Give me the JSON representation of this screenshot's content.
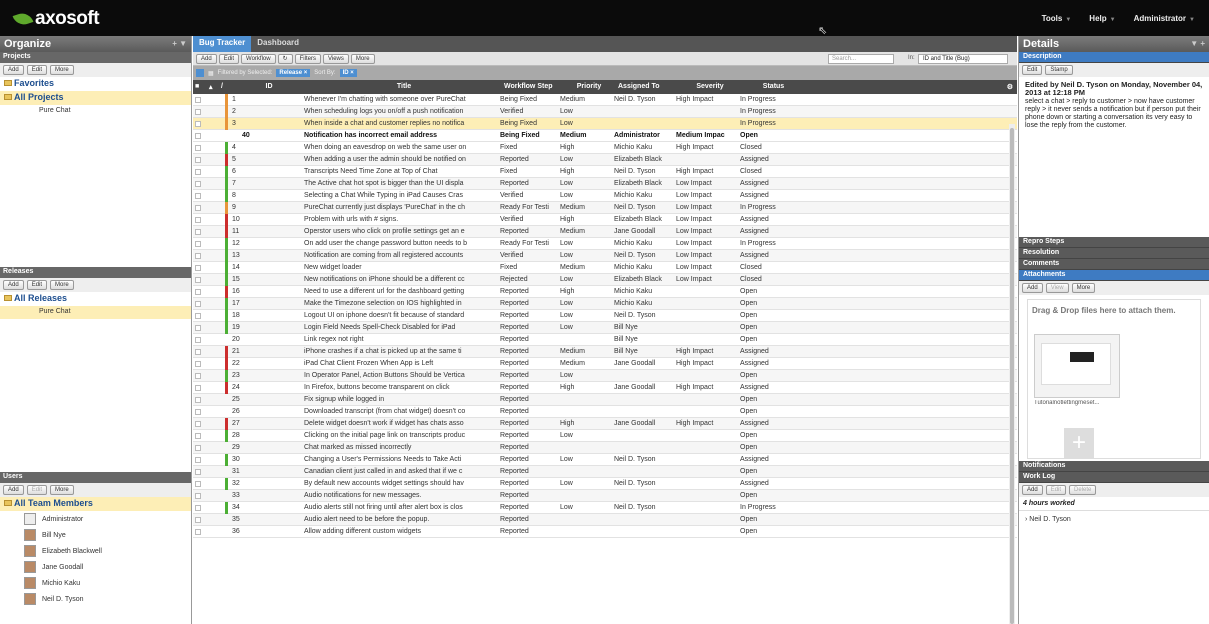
{
  "brand": "axosoft",
  "top_menu": [
    {
      "label": "Tools"
    },
    {
      "label": "Help"
    },
    {
      "label": "Administrator"
    }
  ],
  "organize": {
    "title": "Organize",
    "projects": {
      "header": "Projects",
      "buttons": [
        "Add",
        "Edit",
        "More"
      ],
      "tree": [
        {
          "label": "Favorites"
        },
        {
          "label": "All Projects"
        }
      ],
      "children": [
        "Pure Chat"
      ]
    },
    "releases": {
      "header": "Releases",
      "buttons": [
        "Add",
        "Edit",
        "More"
      ],
      "root": "All Releases",
      "children": [
        "Pure Chat"
      ]
    },
    "users": {
      "header": "Users",
      "buttons": [
        "Add",
        "Edit",
        "More"
      ],
      "root": "All Team Members",
      "members": [
        "Administrator",
        "Bill Nye",
        "Elizabeth Blackwell",
        "Jane Goodall",
        "Michio Kaku",
        "Neil D. Tyson"
      ]
    }
  },
  "tabs": [
    {
      "label": "Bug Tracker",
      "active": true
    },
    {
      "label": "Dashboard",
      "active": false
    }
  ],
  "toolbar": {
    "buttons": [
      "Add",
      "Edit",
      "Workflow",
      "Filters",
      "Views",
      "More"
    ],
    "search_placeholder": "Search...",
    "in_label": "In:",
    "in_value": "ID and Title (Bug)"
  },
  "filter_bar": {
    "filtered_label": "Filtered by Selected:",
    "filter_chip": "Release",
    "sort_label": "Sort By:",
    "sort_chip": "ID"
  },
  "columns": {
    "id": "ID",
    "title": "Title",
    "workflow": "Workflow Step",
    "priority": "Priority",
    "assigned": "Assigned To",
    "severity": "Severity",
    "status": "Status"
  },
  "colors": {
    "accent": "#4e8fd1",
    "selected_row": "#fdeeb6",
    "red": "#cc2e2e",
    "green": "#4caf35",
    "orange": "#e8953a"
  },
  "rows": [
    {
      "id": "1",
      "title": "Whenever I'm chatting with someone over PureChat",
      "wf": "Being Fixed",
      "pr": "Medium",
      "as": "Neil D. Tyson",
      "sv": "High Impact",
      "st": "In Progress",
      "bar": "orange"
    },
    {
      "id": "2",
      "title": "When scheduling logs you on/off a push notification",
      "wf": "Verified",
      "pr": "Low",
      "as": "",
      "sv": "",
      "st": "In Progress",
      "bar": "orange"
    },
    {
      "id": "3",
      "title": "When inside a chat and customer replies no notifica",
      "wf": "Being Fixed",
      "pr": "Low",
      "as": "",
      "sv": "",
      "st": "In Progress",
      "bar": "orange",
      "sel": true
    },
    {
      "id": "40",
      "title": "Notification has incorrect email address",
      "wf": "Being Fixed",
      "pr": "Medium",
      "as": "Administrator",
      "sv": "Medium Impac",
      "st": "Open",
      "bar": "",
      "sub": true
    },
    {
      "id": "4",
      "title": "When doing an eavesdrop on web the same user on",
      "wf": "Fixed",
      "pr": "High",
      "as": "Michio Kaku",
      "sv": "High Impact",
      "st": "Closed",
      "bar": "green"
    },
    {
      "id": "5",
      "title": "When adding a user the admin should be notified on",
      "wf": "Reported",
      "pr": "Low",
      "as": "Elizabeth Black",
      "sv": "",
      "st": "Assigned",
      "bar": "red"
    },
    {
      "id": "6",
      "title": "Transcripts Need Time Zone at Top of Chat",
      "wf": "Fixed",
      "pr": "High",
      "as": "Neil D. Tyson",
      "sv": "High Impact",
      "st": "Closed",
      "bar": "green"
    },
    {
      "id": "7",
      "title": "The Active chat hot spot is bigger than the UI displa",
      "wf": "Reported",
      "pr": "Low",
      "as": "Elizabeth Black",
      "sv": "Low Impact",
      "st": "Assigned",
      "bar": "green"
    },
    {
      "id": "8",
      "title": "Selecting a Chat While Typing in iPad Causes Cras",
      "wf": "Verified",
      "pr": "Low",
      "as": "Michio Kaku",
      "sv": "Low Impact",
      "st": "Assigned",
      "bar": "green"
    },
    {
      "id": "9",
      "title": "PureChat currently just displays 'PureChat' in the ch",
      "wf": "Ready For Testi",
      "pr": "Medium",
      "as": "Neil D. Tyson",
      "sv": "Low Impact",
      "st": "In Progress",
      "bar": "orange"
    },
    {
      "id": "10",
      "title": "Problem with urls with # signs.",
      "wf": "Verified",
      "pr": "High",
      "as": "Elizabeth Black",
      "sv": "Low Impact",
      "st": "Assigned",
      "bar": "red"
    },
    {
      "id": "11",
      "title": "Operstor users who click on profile settings get an e",
      "wf": "Reported",
      "pr": "Medium",
      "as": "Jane Goodall",
      "sv": "Low Impact",
      "st": "Assigned",
      "bar": "red"
    },
    {
      "id": "12",
      "title": "On add user the change password button needs to b",
      "wf": "Ready For Testi",
      "pr": "Low",
      "as": "Michio Kaku",
      "sv": "Low Impact",
      "st": "In Progress",
      "bar": "green"
    },
    {
      "id": "13",
      "title": "Notification are coming from all registered accounts",
      "wf": "Verified",
      "pr": "Low",
      "as": "Neil D. Tyson",
      "sv": "Low Impact",
      "st": "Assigned",
      "bar": "green"
    },
    {
      "id": "14",
      "title": "New widget loader",
      "wf": "Fixed",
      "pr": "Medium",
      "as": "Michio Kaku",
      "sv": "Low Impact",
      "st": "Closed",
      "bar": "green"
    },
    {
      "id": "15",
      "title": "New notifications on iPhone should be a different cc",
      "wf": "Rejected",
      "pr": "Low",
      "as": "Elizabeth Black",
      "sv": "Low Impact",
      "st": "Closed",
      "bar": "green"
    },
    {
      "id": "16",
      "title": "Need to use a different url for the dashboard getting",
      "wf": "Reported",
      "pr": "High",
      "as": "Michio Kaku",
      "sv": "",
      "st": "Open",
      "bar": "red"
    },
    {
      "id": "17",
      "title": "Make the Timezone selection on IOS highlighted in",
      "wf": "Reported",
      "pr": "Low",
      "as": "Michio Kaku",
      "sv": "",
      "st": "Open",
      "bar": "green"
    },
    {
      "id": "18",
      "title": "Logout UI on iphone doesn't fit because of standard",
      "wf": "Reported",
      "pr": "Low",
      "as": "Neil D. Tyson",
      "sv": "",
      "st": "Open",
      "bar": "green"
    },
    {
      "id": "19",
      "title": "Login Field Needs Spell-Check Disabled for iPad",
      "wf": "Reported",
      "pr": "Low",
      "as": "Bill Nye",
      "sv": "",
      "st": "Open",
      "bar": "green"
    },
    {
      "id": "20",
      "title": "Link regex not right",
      "wf": "Reported",
      "pr": "",
      "as": "Bill Nye",
      "sv": "",
      "st": "Open",
      "bar": ""
    },
    {
      "id": "21",
      "title": "iPhone crashes if a chat is picked up at the same ti",
      "wf": "Reported",
      "pr": "Medium",
      "as": "Bill Nye",
      "sv": "High Impact",
      "st": "Assigned",
      "bar": "red"
    },
    {
      "id": "22",
      "title": "iPad Chat Client Frozen When App is Left",
      "wf": "Reported",
      "pr": "Medium",
      "as": "Jane Goodall",
      "sv": "High Impact",
      "st": "Assigned",
      "bar": "red"
    },
    {
      "id": "23",
      "title": "In Operator Panel, Action Buttons Should be Vertica",
      "wf": "Reported",
      "pr": "Low",
      "as": "",
      "sv": "",
      "st": "Open",
      "bar": "green"
    },
    {
      "id": "24",
      "title": "In Firefox, buttons become transparent on click",
      "wf": "Reported",
      "pr": "High",
      "as": "Jane Goodall",
      "sv": "High Impact",
      "st": "Assigned",
      "bar": "red"
    },
    {
      "id": "25",
      "title": "Fix signup while logged in",
      "wf": "Reported",
      "pr": "",
      "as": "",
      "sv": "",
      "st": "Open",
      "bar": ""
    },
    {
      "id": "26",
      "title": "Downloaded transcript (from chat widget) doesn't co",
      "wf": "Reported",
      "pr": "",
      "as": "",
      "sv": "",
      "st": "Open",
      "bar": ""
    },
    {
      "id": "27",
      "title": "Delete widget doesn't work if widget has chats asso",
      "wf": "Reported",
      "pr": "High",
      "as": "Jane Goodall",
      "sv": "High Impact",
      "st": "Assigned",
      "bar": "red"
    },
    {
      "id": "28",
      "title": "Clicking on the initial page link on transcripts produc",
      "wf": "Reported",
      "pr": "Low",
      "as": "",
      "sv": "",
      "st": "Open",
      "bar": "green"
    },
    {
      "id": "29",
      "title": "Chat marked as missed incorrectly",
      "wf": "Reported",
      "pr": "",
      "as": "",
      "sv": "",
      "st": "Open",
      "bar": ""
    },
    {
      "id": "30",
      "title": "Changing a User's Permissions Needs to Take Acti",
      "wf": "Reported",
      "pr": "Low",
      "as": "Neil D. Tyson",
      "sv": "",
      "st": "Assigned",
      "bar": "green"
    },
    {
      "id": "31",
      "title": "Canadian client just called in and asked that if we c",
      "wf": "Reported",
      "pr": "",
      "as": "",
      "sv": "",
      "st": "Open",
      "bar": ""
    },
    {
      "id": "32",
      "title": "By default new accounts widget settings should hav",
      "wf": "Reported",
      "pr": "Low",
      "as": "Neil D. Tyson",
      "sv": "",
      "st": "Assigned",
      "bar": "green"
    },
    {
      "id": "33",
      "title": "Audio notifications for new messages.",
      "wf": "Reported",
      "pr": "",
      "as": "",
      "sv": "",
      "st": "Open",
      "bar": ""
    },
    {
      "id": "34",
      "title": "Audio alerts still not firing until after alert box is clos",
      "wf": "Reported",
      "pr": "Low",
      "as": "Neil D. Tyson",
      "sv": "",
      "st": "In Progress",
      "bar": "green"
    },
    {
      "id": "35",
      "title": "Audio alert need to be before the popup.",
      "wf": "Reported",
      "pr": "",
      "as": "",
      "sv": "",
      "st": "Open",
      "bar": ""
    },
    {
      "id": "36",
      "title": "Allow adding different custom widgets",
      "wf": "Reported",
      "pr": "",
      "as": "",
      "sv": "",
      "st": "Open",
      "bar": ""
    }
  ],
  "details": {
    "title": "Details",
    "description_header": "Description",
    "desc_buttons": [
      "Edit",
      "Stamp"
    ],
    "edited_by": "Edited by Neil D. Tyson on Monday, November 04, 2013 at 12:18 PM",
    "description": "select a chat > reply to customer > now have customer reply > it never sends a notification but if person put their phone down or starting a conversation its very easy to lose the reply from the customer.",
    "sections": [
      "Repro Steps",
      "Resolution",
      "Comments"
    ],
    "attachments_header": "Attachments",
    "attach_buttons": [
      "Add",
      "View",
      "More"
    ],
    "drop_text": "Drag & Drop files here to attach them.",
    "attachment_name": "Tutorialnotlettingmeset...",
    "notifications_header": "Notifications",
    "worklog_header": "Work Log",
    "worklog_buttons": [
      "Add",
      "Edit",
      "Delete"
    ],
    "hours_worked": "4 hours worked",
    "worklog_entry": "Neil D. Tyson"
  }
}
